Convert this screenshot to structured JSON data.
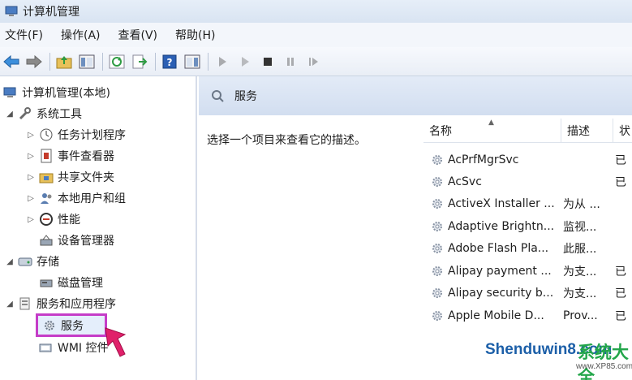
{
  "window": {
    "title": "计算机管理"
  },
  "menu": [
    {
      "label": "文件(F)"
    },
    {
      "label": "操作(A)"
    },
    {
      "label": "查看(V)"
    },
    {
      "label": "帮助(H)"
    }
  ],
  "tree": {
    "root": "计算机管理(本地)",
    "system_tools": "系统工具",
    "task_scheduler": "任务计划程序",
    "event_viewer": "事件查看器",
    "shared_folders": "共享文件夹",
    "local_users": "本地用户和组",
    "performance": "性能",
    "device_manager": "设备管理器",
    "storage": "存储",
    "disk_management": "磁盘管理",
    "services_apps": "服务和应用程序",
    "services": "服务",
    "wmi": "WMI 控件"
  },
  "right_pane": {
    "header_title": "服务",
    "description_hint": "选择一个项目来查看它的描述。",
    "columns": {
      "name": "名称",
      "description": "描述",
      "status": "状"
    }
  },
  "services": [
    {
      "name": "AcPrfMgrSvc",
      "description": "",
      "status": "已"
    },
    {
      "name": "AcSvc",
      "description": "",
      "status": "已"
    },
    {
      "name": "ActiveX Installer ...",
      "description": "为从 ...",
      "status": ""
    },
    {
      "name": "Adaptive Brightn...",
      "description": "监视...",
      "status": ""
    },
    {
      "name": "Adobe Flash Pla...",
      "description": "此服...",
      "status": ""
    },
    {
      "name": "Alipay payment ...",
      "description": "为支...",
      "status": "已"
    },
    {
      "name": "Alipay security b...",
      "description": "为支...",
      "status": "已"
    },
    {
      "name": "Apple Mobile D...",
      "description": "Prov...",
      "status": "已"
    }
  ],
  "watermark": {
    "brand": "Shenduwin8.com",
    "brand_cn": "系统大全",
    "url": "www.XP85.com"
  },
  "colors": {
    "highlight_border": "#c53cc8",
    "header_bg": "#d2def0",
    "accent": "#1c5fa8"
  }
}
